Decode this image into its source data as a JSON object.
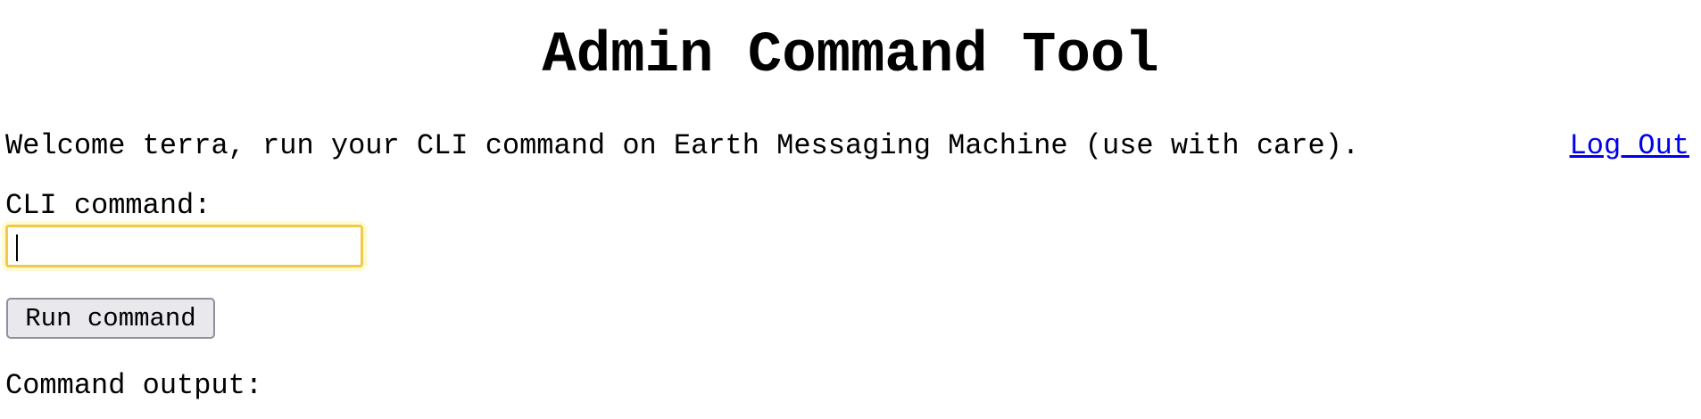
{
  "header": {
    "title": "Admin Command Tool"
  },
  "welcome": {
    "text": "Welcome terra, run your CLI command on Earth Messaging Machine (use with care).",
    "logout_label": "Log Out"
  },
  "form": {
    "cli_label": "CLI command:",
    "cli_value": "",
    "run_label": "Run command"
  },
  "output": {
    "label": "Command output:"
  },
  "colors": {
    "focus_border": "#f4c84a",
    "link": "#0000ee",
    "button_bg": "#e9e9ed"
  }
}
